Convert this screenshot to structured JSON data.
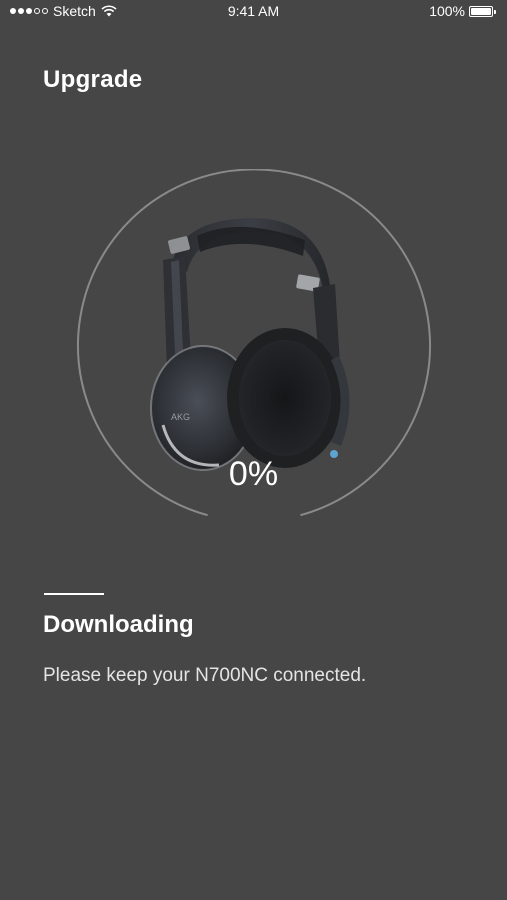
{
  "status_bar": {
    "carrier": "Sketch",
    "time": "9:41 AM",
    "battery_percent": "100%",
    "signal_bars_filled": 3,
    "signal_bars_total": 5,
    "battery_level": 1.0
  },
  "header": {
    "title": "Upgrade"
  },
  "progress": {
    "percent_label": "0%",
    "value": 0,
    "ring_color": "#8a8a8a",
    "image_subject": "headphones"
  },
  "status": {
    "title": "Downloading",
    "message": "Please keep your N700NC connected."
  },
  "colors": {
    "background": "#464646",
    "text": "#ffffff",
    "secondary_text": "#e4e4e4"
  }
}
